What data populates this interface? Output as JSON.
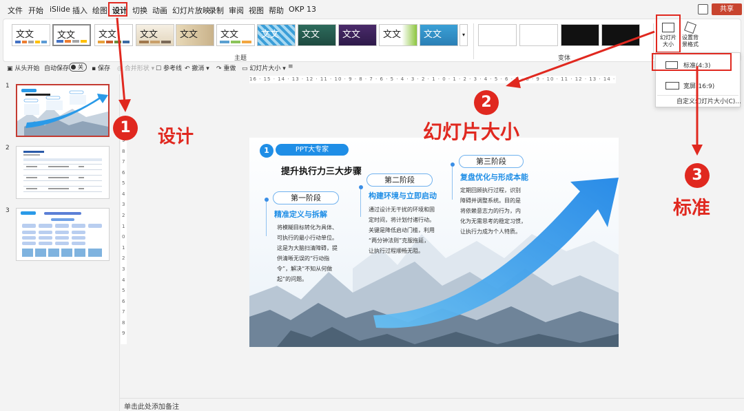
{
  "menu": {
    "items": [
      "文件",
      "开始",
      "iSlide",
      "插入",
      "绘图",
      "设计",
      "切换",
      "动画",
      "幻灯片放映",
      "录制",
      "审阅",
      "视图",
      "帮助",
      "OKP 13"
    ],
    "share_label": "共享"
  },
  "ribbon": {
    "theme_sample_text": "文文",
    "themes_group_label": "主题",
    "variants_group_label": "变体",
    "slide_size_label": "幻灯片大小",
    "format_bg_label": "设置背景格式"
  },
  "qat": {
    "from_start": "从头开始",
    "autosave": "自动保存",
    "autosave_state": "关",
    "save": "保存",
    "merge_shapes": "合并形状",
    "guides": "参考线",
    "undo": "撤消",
    "redo": "重做",
    "slide_size": "幻灯片大小"
  },
  "thumbnails": [
    {
      "number": "1"
    },
    {
      "number": "2"
    },
    {
      "number": "3"
    }
  ],
  "rulers": {
    "horizontal": "16 · 15 · 14 · 13 · 12 · 11 · 10 · 9 · 8 · 7 · 6 · 5 · 4 · 3 · 2 · 1 · 0 · 1 · 2 · 3 · 4 · 5 · 6 · 7 · 8 · 9 · 10 · 11 · 12 · 13 · 14 · 15 · 16",
    "vertical": [
      "9",
      "8",
      "7",
      "6",
      "5",
      "4",
      "3",
      "2",
      "1",
      "0",
      "1",
      "2",
      "3",
      "4",
      "5",
      "6",
      "7",
      "8",
      "9"
    ]
  },
  "slide": {
    "badge_number": "1",
    "tag": "PPT大专家",
    "title": "提升执行力三大步骤",
    "stages": [
      {
        "label": "第一阶段",
        "title": "精准定义与拆解",
        "body": "将模糊目标转化为具体、\n可执行的最小行动单位。\n这是为大脑扫清障碍，提\n供清晰无误的“行动指\n令”，解决“不知从何做\n起”的问题。"
      },
      {
        "label": "第二阶段",
        "title": "构建环境与立即启动",
        "body": "通过设计无干扰的环境和固\n定时间，将计划付诸行动。\n关键是降低启动门槛，利用\n“两分钟法则”克服拖延，\n让执行过程顺畅无阻。"
      },
      {
        "label": "第三阶段",
        "title": "复盘优化与形成本能",
        "body": "定期回顾执行过程，识别\n障碍并调整系统。目的是\n将依赖意志力的行为，内\n化为无需思考的稳定习惯，\n让执行力成为个人特质。"
      }
    ]
  },
  "dropdown": {
    "standard": "标准(4:3)",
    "widescreen": "宽屏(16:9)",
    "custom": "自定义幻灯片大小(C)..."
  },
  "notes_placeholder": "单击此处添加备注",
  "annotations": {
    "step1_number": "1",
    "step1_text": "设计",
    "step2_number": "2",
    "step2_text": "幻灯片大小",
    "step3_number": "3",
    "step3_text": "标准"
  },
  "colors": {
    "accent_red": "#e0281f",
    "share_button": "#c8442f",
    "slide_blue": "#1f8ee6"
  }
}
